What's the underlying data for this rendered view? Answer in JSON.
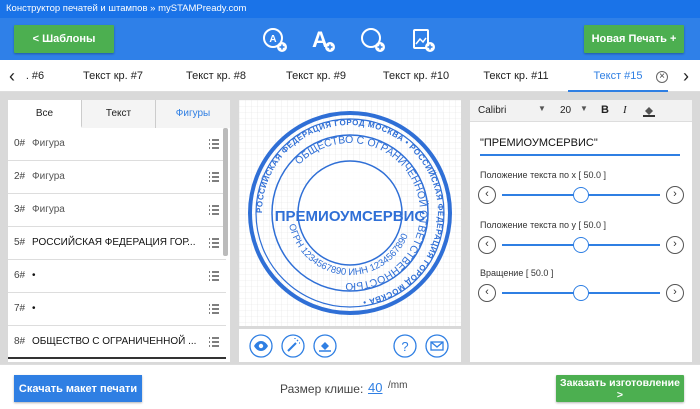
{
  "window": {
    "title": "Конструктор печатей и штампов » mySTAMPready.com"
  },
  "toolbar": {
    "templates_label": "<  Шаблоны",
    "new_stamp_label": "Новая Печать +",
    "tools": [
      "add-circle-text-icon",
      "add-text-icon",
      "add-circle-icon",
      "add-image-icon"
    ]
  },
  "tabs": {
    "prev_arrow": "‹",
    "next_arrow": "›",
    "items": [
      {
        "label": ". #6"
      },
      {
        "label": "Текст кр. #7"
      },
      {
        "label": "Текст кр. #8"
      },
      {
        "label": "Текст кр. #9"
      },
      {
        "label": "Текст кр. #10"
      },
      {
        "label": "Текст кр. #11"
      },
      {
        "label": "Текст #15"
      }
    ],
    "close_symbol": "×"
  },
  "layers": {
    "tabs": [
      "Все",
      "Текст",
      "Фигуры"
    ],
    "rows": [
      {
        "num": "0#",
        "label": "Фигура"
      },
      {
        "num": "2#",
        "label": "Фигура"
      },
      {
        "num": "3#",
        "label": "Фигура"
      },
      {
        "num": "5#",
        "label": "РОССИЙСКАЯ ФЕДЕРАЦИЯ ГОР..."
      },
      {
        "num": "6#",
        "label": "•"
      },
      {
        "num": "7#",
        "label": "•"
      },
      {
        "num": "8#",
        "label": "ОБЩЕСТВО С ОГРАНИЧЕННОЙ ..."
      }
    ]
  },
  "stamp": {
    "center_text": "ПРЕМИОУМСЕРВИС",
    "outer_text": "РОССИЙСКАЯ ФЕДЕРАЦИЯ ГОРОД МОСКВА • РОССИЙСКАЯ ФЕДЕРАЦИЯ ГОРОД МОСКВА •",
    "inner_text": "ОБЩЕСТВО С ОГРАНИЧЕННОЙ ОТВЕТСТВЕННОСТЬЮ",
    "bottom_text": "ОГРН 1234567890 ИНН 1234567890",
    "color": "#2f6fd6"
  },
  "canvas_tools": [
    "eye-icon",
    "magic-wand-icon",
    "fill-icon",
    "help-icon",
    "mail-icon"
  ],
  "properties": {
    "font": "Calibri",
    "size": "20",
    "bold": "B",
    "italic": "I",
    "text_value": "\"ПРЕМИОУМСЕРВИС\"",
    "sliders": [
      {
        "label": "Положение текста по x [ 50.0 ]",
        "value": 0.5
      },
      {
        "label": "Положение текста по y [ 50.0 ]",
        "value": 0.5
      },
      {
        "label": "Вращение [ 50.0 ]",
        "value": 0.5
      }
    ],
    "left_arrow": "‹",
    "right_arrow": "›"
  },
  "bottom": {
    "download_label": "Скачать макет печати",
    "size_label": "Размер клише:",
    "size_value": "40",
    "size_unit": "/mm",
    "order_label": "Заказать изготовление >"
  },
  "colors": {
    "accent": "#2f80e8",
    "green": "#4caf50"
  }
}
